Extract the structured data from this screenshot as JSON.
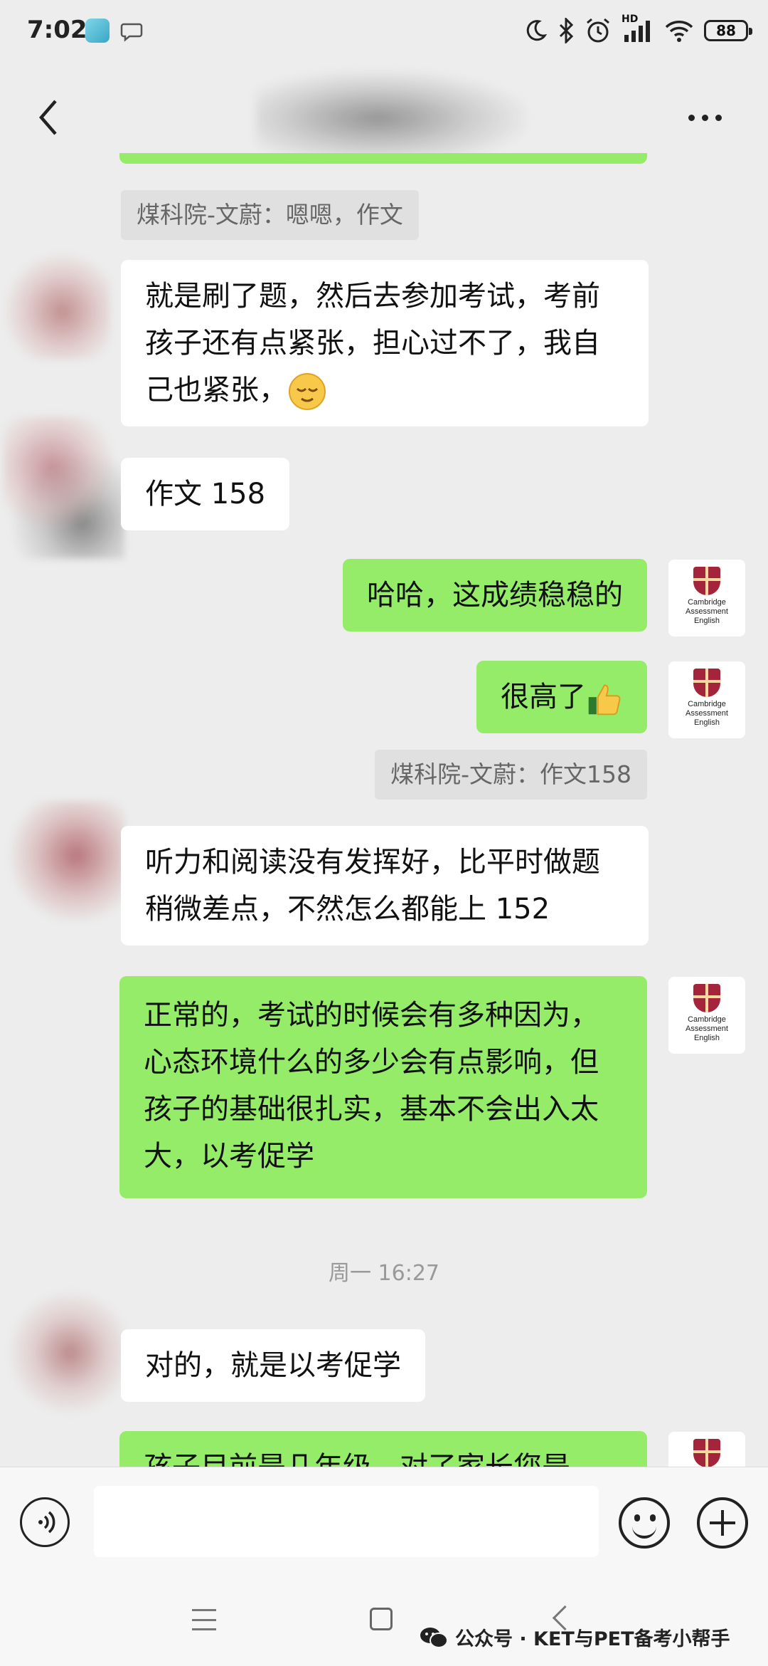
{
  "status_bar": {
    "time": "7:02",
    "network_label": "HD",
    "battery": "88"
  },
  "header": {
    "title": ""
  },
  "messages": [
    {
      "side": "right",
      "text": "",
      "partial": true
    },
    {
      "type": "quote",
      "side": "left",
      "text": "煤科院-文蔚：嗯嗯，作文"
    },
    {
      "side": "left",
      "text": "就是刷了题，然后去参加考试，考前孩子还有点紧张，担心过不了，我自己也紧张，",
      "emoji": "relieved-face"
    },
    {
      "side": "left",
      "text": "作文 158"
    },
    {
      "side": "right",
      "text": "哈哈，这成绩稳稳的"
    },
    {
      "side": "right",
      "text": "很高了",
      "emoji": "thumbs-up"
    },
    {
      "type": "quote",
      "side": "right",
      "text": "煤科院-文蔚：作文158"
    },
    {
      "side": "left",
      "text": "听力和阅读没有发挥好，比平时做题稍微差点，不然怎么都能上 152"
    },
    {
      "side": "right",
      "text": "正常的，考试的时候会有多种因为，心态环境什么的多少会有点影响，但孩子的基础很扎实，基本不会出入太大，以考促学"
    },
    {
      "type": "time",
      "text": "周一 16:27"
    },
    {
      "side": "left",
      "text": "对的，就是以考促学"
    },
    {
      "side": "right",
      "text": "孩子目前是几年级，对了家长您是",
      "partial": true
    }
  ],
  "avatar_logo": {
    "line1": "Cambridge",
    "line2": "Assessment",
    "line3": "English"
  },
  "colors": {
    "background": "#ededed",
    "right_bubble": "#95ec69",
    "left_bubble": "#ffffff"
  },
  "watermark": {
    "text": "公众号 · KET与PET备考小帮手"
  }
}
